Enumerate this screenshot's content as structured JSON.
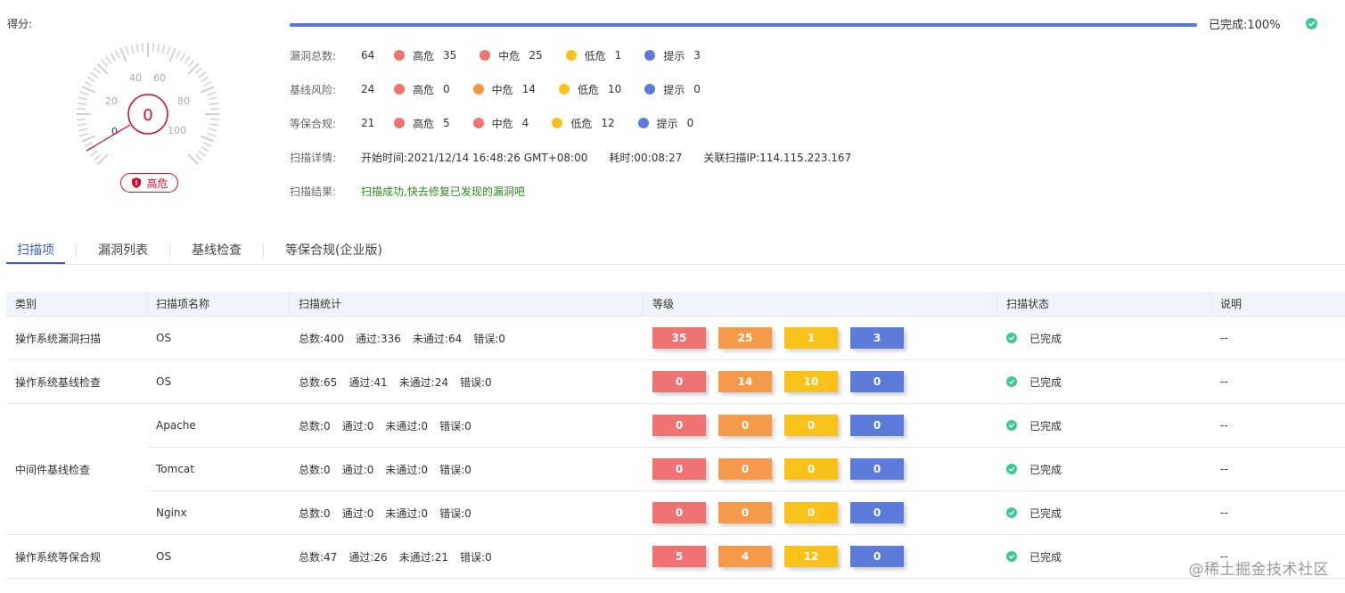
{
  "score": {
    "label": "得分:",
    "value": "0",
    "gauge_ticks": [
      "0",
      "20",
      "40",
      "60",
      "80",
      "100"
    ],
    "risk_label": "高危"
  },
  "progress": {
    "text": "已完成:100%",
    "percent": 100
  },
  "colors": {
    "high": "#f07373",
    "mid_red": "#ef6f6f",
    "mid": "#f5963f",
    "low": "#f8c21a",
    "tip": "#5d7bdb",
    "ok": "#3dc79b",
    "accent": "#3f5fbf"
  },
  "summary": {
    "vuln": {
      "label": "漏洞总数:",
      "total": "64",
      "items": [
        {
          "name": "高危",
          "count": "35",
          "color": "#f07373"
        },
        {
          "name": "中危",
          "count": "25",
          "color": "#f07373"
        },
        {
          "name": "低危",
          "count": "1",
          "color": "#f8c21a"
        },
        {
          "name": "提示",
          "count": "3",
          "color": "#5d7bdb"
        }
      ]
    },
    "baseline": {
      "label": "基线风险:",
      "total": "24",
      "items": [
        {
          "name": "高危",
          "count": "0",
          "color": "#f07373"
        },
        {
          "name": "中危",
          "count": "14",
          "color": "#f5963f"
        },
        {
          "name": "低危",
          "count": "10",
          "color": "#f8c21a"
        },
        {
          "name": "提示",
          "count": "0",
          "color": "#5d7bdb"
        }
      ]
    },
    "compliance": {
      "label": "等保合规:",
      "total": "21",
      "items": [
        {
          "name": "高危",
          "count": "5",
          "color": "#f07373"
        },
        {
          "name": "中危",
          "count": "4",
          "color": "#f07373"
        },
        {
          "name": "低危",
          "count": "12",
          "color": "#f8c21a"
        },
        {
          "name": "提示",
          "count": "0",
          "color": "#5d7bdb"
        }
      ]
    },
    "detail": {
      "label": "扫描详情:",
      "start": "开始时间:2021/12/14 16:48:26 GMT+08:00",
      "duration": "耗时:00:08:27",
      "ip": "关联扫描IP:114.115.223.167"
    },
    "result": {
      "label": "扫描结果:",
      "text": "扫描成功,快去修复已发现的漏洞吧"
    }
  },
  "tabs": [
    "扫描项",
    "漏洞列表",
    "基线检查",
    "等保合规(企业版)"
  ],
  "table": {
    "headers": [
      "类别",
      "扫描项名称",
      "扫描统计",
      "等级",
      "扫描状态",
      "说明"
    ],
    "rows": [
      {
        "category": "操作系统漏洞扫描",
        "name": "OS",
        "stats": [
          "总数:400",
          "通过:336",
          "未通过:64",
          "错误:0"
        ],
        "levels": [
          "35",
          "25",
          "1",
          "3"
        ],
        "status": "已完成",
        "note": "--"
      },
      {
        "category": "操作系统基线检查",
        "name": "OS",
        "stats": [
          "总数:65",
          "通过:41",
          "未通过:24",
          "错误:0"
        ],
        "levels": [
          "0",
          "14",
          "10",
          "0"
        ],
        "status": "已完成",
        "note": "--"
      },
      {
        "category": "",
        "name": "Apache",
        "stats": [
          "总数:0",
          "通过:0",
          "未通过:0",
          "错误:0"
        ],
        "levels": [
          "0",
          "0",
          "0",
          "0"
        ],
        "status": "已完成",
        "note": "--"
      },
      {
        "category": "",
        "name": "Tomcat",
        "stats": [
          "总数:0",
          "通过:0",
          "未通过:0",
          "错误:0"
        ],
        "levels": [
          "0",
          "0",
          "0",
          "0"
        ],
        "status": "已完成",
        "note": "--"
      },
      {
        "category": "",
        "name": "Nginx",
        "stats": [
          "总数:0",
          "通过:0",
          "未通过:0",
          "错误:0"
        ],
        "levels": [
          "0",
          "0",
          "0",
          "0"
        ],
        "status": "已完成",
        "note": "--"
      },
      {
        "category": "操作系统等保合规",
        "name": "OS",
        "stats": [
          "总数:47",
          "通过:26",
          "未通过:21",
          "错误:0"
        ],
        "levels": [
          "5",
          "4",
          "12",
          "0"
        ],
        "status": "已完成",
        "note": "--"
      }
    ],
    "merged_category": "中间件基线检查"
  },
  "watermark": "@稀土掘金技术社区"
}
